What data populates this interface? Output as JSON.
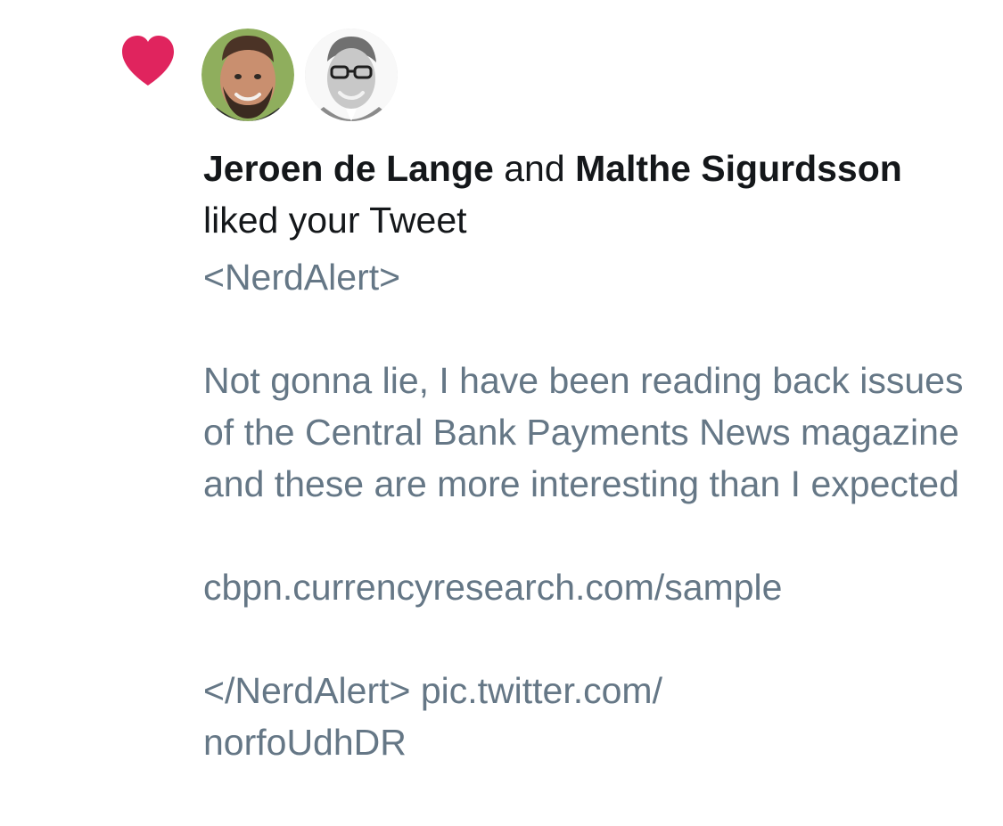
{
  "notification": {
    "icon": "heart-icon",
    "accent_color": "#e0245e",
    "text_color": "#14171a",
    "secondary_text_color": "#657786",
    "avatars": [
      {
        "name": "Jeroen de Lange",
        "icon": "avatar-photo"
      },
      {
        "name": "Malthe Sigurdsson",
        "icon": "avatar-photo"
      }
    ],
    "user_one": "Jeroen de Lange",
    "connector": "and",
    "user_two": "Malthe Sigurdsson",
    "action": "liked your Tweet"
  },
  "tweet": {
    "line_open_tag": "<NerdAlert>",
    "paragraph": "Not gonna lie, I have been reading back issues of the Central Bank Payments News magazine and these are more interesting than I expected",
    "link": "cbpn.currencyresearch.com/sample",
    "line_close_tag": "</NerdAlert> pic.twitter.com/",
    "line_close_tag_cont": "norfoUdhDR"
  }
}
